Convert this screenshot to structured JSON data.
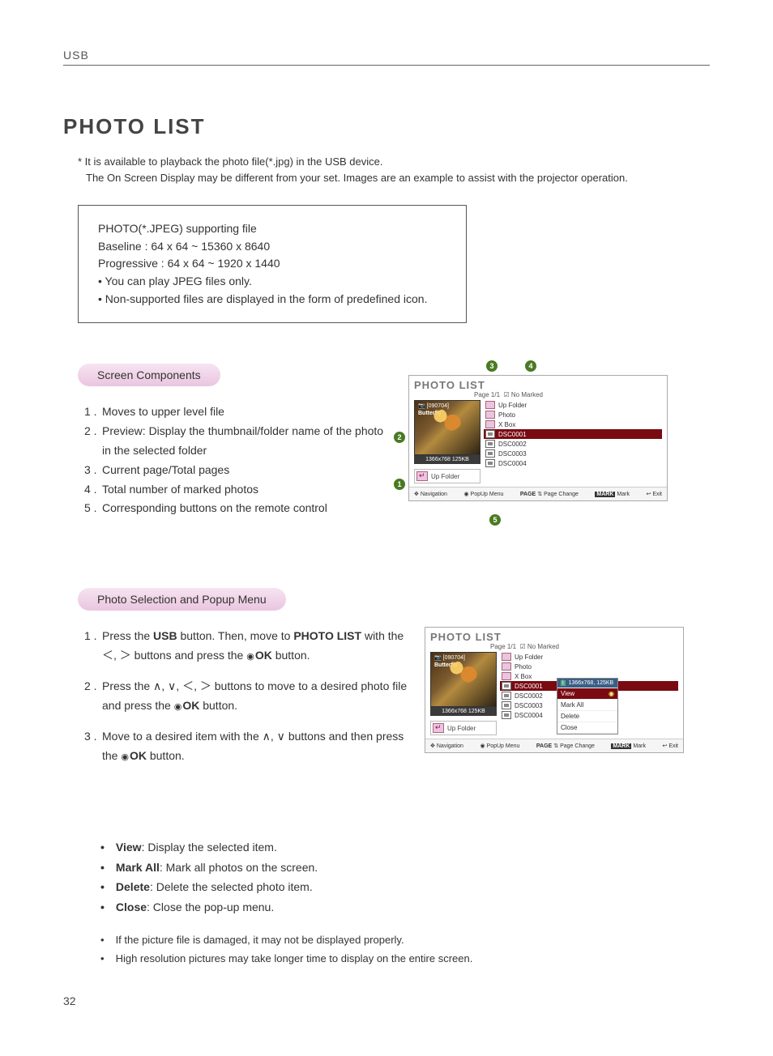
{
  "header": {
    "section": "USB"
  },
  "title": "PHOTO LIST",
  "intro": {
    "line1": "* It is available to playback the photo file(*.jpg) in the USB device.",
    "line2": "The On Screen Display may be different from your set. Images are an example to assist with the projector operation."
  },
  "support_box": {
    "line1": "PHOTO(*.JPEG) supporting file",
    "line2": "Baseline : 64 x 64 ~ 15360 x 8640",
    "line3": "Progressive : 64 x 64 ~ 1920 x 1440",
    "bullet1": "• You can play JPEG files only.",
    "bullet2": "• Non-supported files are displayed in the form of predefined icon."
  },
  "section1": {
    "heading": "Screen Components",
    "items": [
      "Moves to upper level file",
      "Preview: Display the thumbnail/folder name of the photo in the selected folder",
      "Current page/Total pages",
      "Total number of marked photos",
      "Corresponding buttons on the remote control"
    ]
  },
  "osd1": {
    "title": "PHOTO LIST",
    "page": "Page 1/1",
    "marked": "No Marked",
    "preview_folder": "[090704]",
    "preview_name": "Butterfly",
    "preview_meta": "1366x768  125KB",
    "up_folder": "Up Folder",
    "rows": [
      {
        "icon": "folder",
        "label": "Up Folder"
      },
      {
        "icon": "folder",
        "label": "Photo"
      },
      {
        "icon": "folder",
        "label": "X Box"
      },
      {
        "icon": "pic",
        "label": "DSC0001",
        "selected": true
      },
      {
        "icon": "pic",
        "label": "DSC0002"
      },
      {
        "icon": "pic",
        "label": "DSC0003"
      },
      {
        "icon": "pic",
        "label": "DSC0004"
      }
    ],
    "footer": {
      "nav": "Navigation",
      "popup": "PopUp Menu",
      "page_change_prefix": "PAGE",
      "page_change": "Page Change",
      "mark_prefix": "MARK",
      "mark": "Mark",
      "exit": "Exit"
    },
    "callouts": {
      "c1": "1",
      "c2": "2",
      "c3": "3",
      "c4": "4",
      "c5": "5"
    }
  },
  "section2": {
    "heading": "Photo Selection and Popup Menu",
    "steps": {
      "s1a": "Press the ",
      "s1b": "USB",
      "s1c": " button. Then, move to ",
      "s1d": "PHOTO LIST",
      "s1e": " with the ",
      "s1f": " buttons and press the ",
      "s1g": "OK",
      "s1h": " button.",
      "s2a": "Press the ",
      "s2b": " buttons to move to a desired photo file and press the ",
      "s2c": "OK",
      "s2d": " button.",
      "s3a": "Move to a desired item with the ",
      "s3b": " buttons and then press the ",
      "s3c": "OK",
      "s3d": " button."
    }
  },
  "osd2": {
    "title": "PHOTO LIST",
    "page": "Page 1/1",
    "marked": "No Marked",
    "preview_folder": "[090704]",
    "preview_name": "Butterfly",
    "preview_meta": "1366x768  125KB",
    "up_folder": "Up Folder",
    "rows": [
      {
        "icon": "folder",
        "label": "Up Folder"
      },
      {
        "icon": "folder",
        "label": "Photo"
      },
      {
        "icon": "folder",
        "label": "X Box"
      },
      {
        "icon": "pic",
        "label": "DSC0001",
        "selected": true
      },
      {
        "icon": "pic",
        "label": "DSC0002"
      },
      {
        "icon": "pic",
        "label": "DSC0003"
      },
      {
        "icon": "pic",
        "label": "DSC0004"
      }
    ],
    "popup": {
      "info": "1366x768, 125KB",
      "view": "View",
      "markall": "Mark All",
      "delete": "Delete",
      "close": "Close"
    },
    "footer": {
      "nav": "Navigation",
      "popup": "PopUp Menu",
      "page_change_prefix": "PAGE",
      "page_change": "Page Change",
      "mark_prefix": "MARK",
      "mark": "Mark",
      "exit": "Exit"
    }
  },
  "descriptions": [
    {
      "term": "View",
      "text": ": Display the selected item."
    },
    {
      "term": "Mark All",
      "text": ": Mark all photos on the screen."
    },
    {
      "term": "Delete",
      "text": ": Delete the selected photo item."
    },
    {
      "term": "Close",
      "text": ": Close the pop-up menu."
    }
  ],
  "notes": [
    "If the picture file is damaged, it may not be displayed properly.",
    "High resolution pictures may take longer time to display on the entire screen."
  ],
  "page_number": "32"
}
